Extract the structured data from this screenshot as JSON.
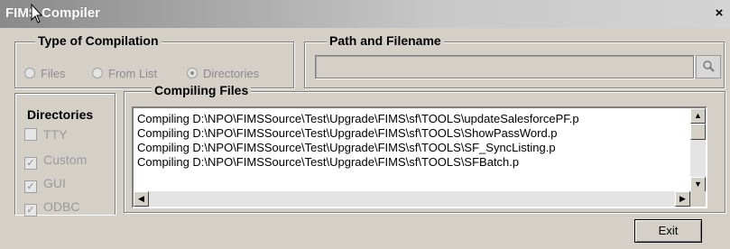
{
  "window": {
    "title": "FIMS Compiler",
    "close_glyph": "×"
  },
  "compilation_type": {
    "label": "Type of Compilation",
    "options": [
      {
        "label": "Files",
        "selected": false
      },
      {
        "label": "From List",
        "selected": false
      },
      {
        "label": "Directories",
        "selected": true
      }
    ]
  },
  "path": {
    "label": "Path and Filename",
    "value": "",
    "browse_icon": "search-icon"
  },
  "directories": {
    "label": "Directories",
    "items": [
      {
        "label": "TTY",
        "checked": false
      },
      {
        "label": "Custom",
        "checked": true
      },
      {
        "label": "GUI",
        "checked": true
      },
      {
        "label": "ODBC",
        "checked": true
      }
    ]
  },
  "compiling": {
    "label": "Compiling Files",
    "lines": [
      "Compiling D:\\NPO\\FIMSSource\\Test\\Upgrade\\FIMS\\sf\\TOOLS\\updateSalesforcePF.p",
      "Compiling D:\\NPO\\FIMSSource\\Test\\Upgrade\\FIMS\\sf\\TOOLS\\ShowPassWord.p",
      "Compiling D:\\NPO\\FIMSSource\\Test\\Upgrade\\FIMS\\sf\\TOOLS\\SF_SyncListing.p",
      "Compiling D:\\NPO\\FIMSSource\\Test\\Upgrade\\FIMS\\sf\\TOOLS\\SFBatch.p"
    ]
  },
  "buttons": {
    "exit": "Exit"
  }
}
